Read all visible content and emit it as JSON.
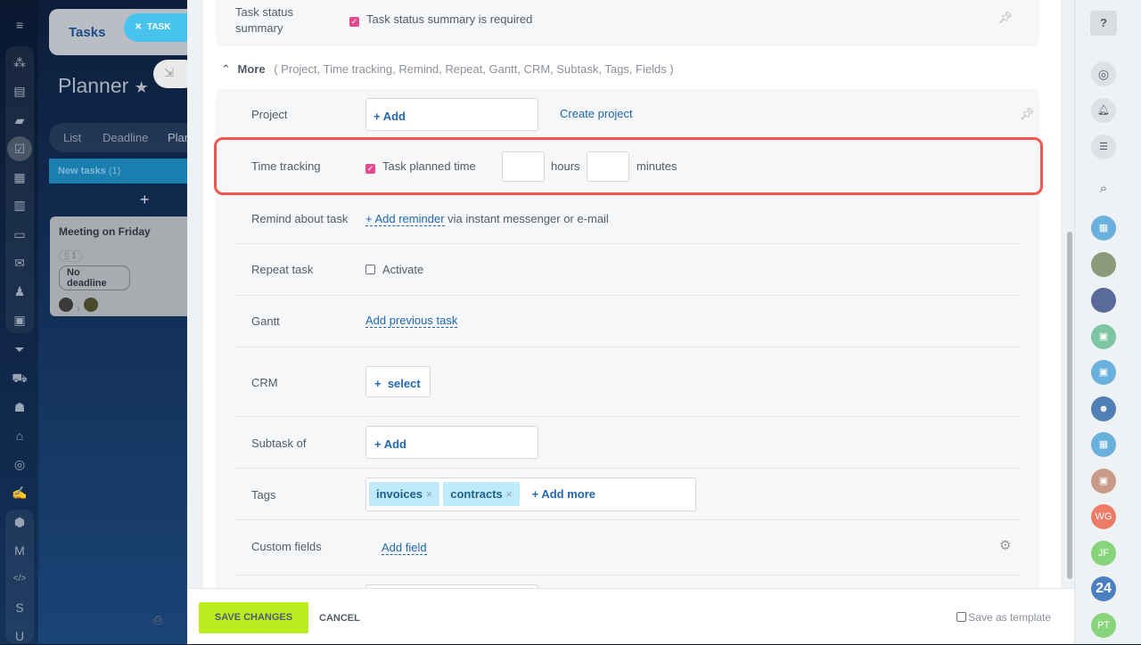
{
  "left_nav": {
    "icons": [
      "menu-icon",
      "sites-icon",
      "feed-icon",
      "chat-icon",
      "tasks-icon",
      "calendar-icon",
      "docs-icon",
      "drive-icon",
      "mail-icon",
      "groups-icon",
      "contacts-icon",
      "crm-filter-icon",
      "shop-icon",
      "robot-icon",
      "bank-icon",
      "target-icon",
      "sign-icon",
      "box-icon",
      "marketplace-icon",
      "code-icon"
    ],
    "letters": [
      "S",
      "U"
    ]
  },
  "background": {
    "tab": "Tasks",
    "task_pill": "TASK",
    "title": "Planner",
    "views": [
      "List",
      "Deadline",
      "Plan"
    ],
    "stage": "New tasks",
    "stage_count": "(1)",
    "card": {
      "title": "Meeting on Friday",
      "count": "1",
      "deadline": "No deadline"
    }
  },
  "form": {
    "status_summary": {
      "label": "Task status summary",
      "checkbox": "Task status summary is required",
      "checked": true
    },
    "more": {
      "label": "More",
      "items": "( Project,  Time tracking,  Remind,  Repeat,  Gantt,  CRM,  Subtask,  Tags,  Fields )"
    },
    "project": {
      "label": "Project",
      "add": "+ Add",
      "create": "Create project"
    },
    "time_tracking": {
      "label": "Time tracking",
      "checkbox": "Task planned time",
      "checked": true,
      "hours_value": "",
      "hours": "hours",
      "minutes_value": "",
      "minutes": "minutes",
      "highlight_color": "#f0574f"
    },
    "remind": {
      "label": "Remind about task",
      "link": "+ Add reminder",
      "text": "via instant messenger or e-mail"
    },
    "repeat": {
      "label": "Repeat task",
      "checkbox": "Activate",
      "checked": false
    },
    "gantt": {
      "label": "Gantt",
      "link": "Add previous task"
    },
    "crm": {
      "label": "CRM",
      "button": "+  select"
    },
    "subtask": {
      "label": "Subtask of",
      "add": "+ Add"
    },
    "tags": {
      "label": "Tags",
      "items": [
        "invoices",
        "contracts"
      ],
      "add": "+ Add more"
    },
    "custom": {
      "label": "Custom fields",
      "link": "Add field"
    }
  },
  "footer": {
    "save": "SAVE CHANGES",
    "cancel": "CANCEL",
    "template": "Save as template",
    "save_color": "#bbed21"
  },
  "right_panel": {
    "avatars": [
      {
        "type": "icon",
        "color": "#6ab0dd",
        "icon": "calendar-icon"
      },
      {
        "type": "photo",
        "color": "#8a9a7a"
      },
      {
        "type": "photo",
        "color": "#5a6a9a"
      },
      {
        "type": "icon",
        "color": "#7cc6a3",
        "icon": "contact-card-icon"
      },
      {
        "type": "icon",
        "color": "#6ab0dd",
        "icon": "contact-card-icon"
      },
      {
        "type": "icon",
        "color": "#4f7fb5",
        "icon": "group-chat-icon"
      },
      {
        "type": "icon",
        "color": "#6ab0dd",
        "icon": "calendar-icon"
      },
      {
        "type": "icon",
        "color": "#c99a88",
        "icon": "contact-card-icon"
      },
      {
        "type": "text",
        "color": "#ee7b65",
        "text": "WG"
      },
      {
        "type": "text",
        "color": "#88d47a",
        "text": "JF"
      },
      {
        "type": "text",
        "color": "#4a7fc1",
        "text": "24"
      },
      {
        "type": "text",
        "color": "#88d47a",
        "text": "PT"
      }
    ]
  }
}
